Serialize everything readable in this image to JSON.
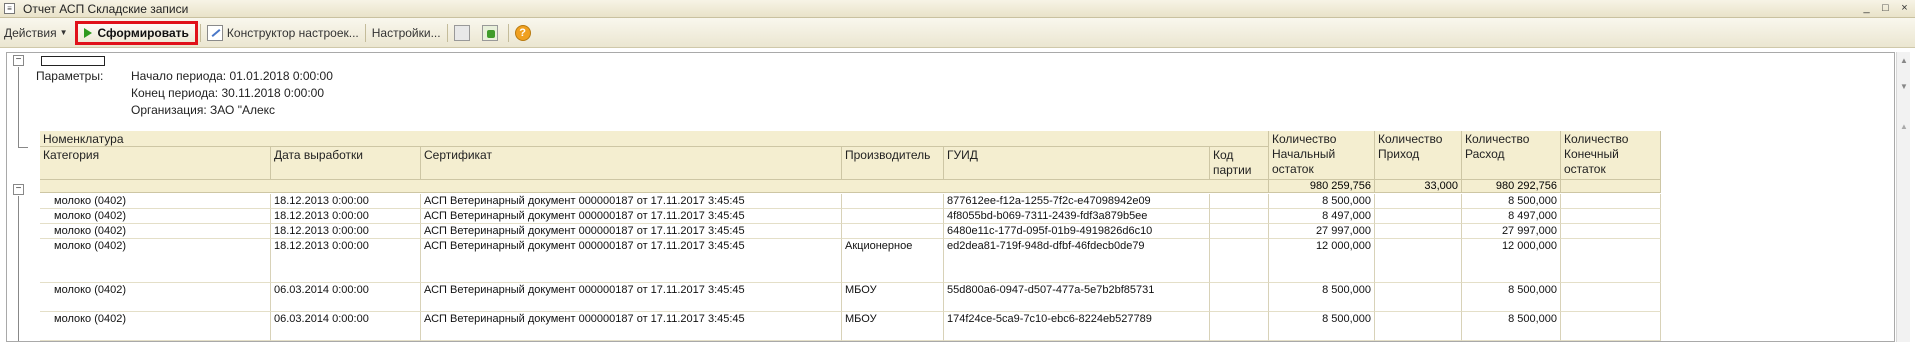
{
  "window": {
    "title": "Отчет  АСП Складские записи",
    "app_icon": "1c-document-icon",
    "controls": [
      "_",
      "□",
      "×"
    ]
  },
  "toolbar": {
    "actions_label": "Действия",
    "generate_label": "Сформировать",
    "designer_label": "Конструктор настроек...",
    "settings_label": "Настройки...",
    "help_glyph": "?"
  },
  "params": {
    "label": "Параметры:",
    "period_start": "Начало периода: 01.01.2018 0:00:00",
    "period_end": "Конец периода: 30.11.2018 0:00:00",
    "organization": "Организация: ЗАО \"Алекс"
  },
  "table": {
    "header_top": "Номенклатура",
    "columns": {
      "category": "Категория",
      "date": "Дата выработки",
      "cert": "Сертификат",
      "producer": "Производитель",
      "guid": "ГУИД",
      "batch": "Код партии",
      "qty_start": "Количество Начальный остаток",
      "qty_in": "Количество Приход",
      "qty_out": "Количество Расход",
      "qty_end": "Количество Конечный остаток"
    },
    "totals": {
      "qty_start": "980 259,756",
      "qty_in": "33,000",
      "qty_out": "980 292,756",
      "qty_end": ""
    },
    "rows": [
      {
        "category": "молоко (0402)",
        "date": "18.12.2013 0:00:00",
        "cert": "АСП Ветеринарный документ 000000187 от 17.11.2017 3:45:45",
        "producer": "",
        "guid": "877612ee-f12a-1255-7f2c-e47098942e09",
        "batch": "",
        "qty_start": "8 500,000",
        "qty_in": "",
        "qty_out": "8 500,000",
        "qty_end": ""
      },
      {
        "category": "молоко (0402)",
        "date": "18.12.2013 0:00:00",
        "cert": "АСП Ветеринарный документ 000000187 от 17.11.2017 3:45:45",
        "producer": "",
        "guid": "4f8055bd-b069-7311-2439-fdf3a879b5ee",
        "batch": "",
        "qty_start": "8 497,000",
        "qty_in": "",
        "qty_out": "8 497,000",
        "qty_end": ""
      },
      {
        "category": "молоко (0402)",
        "date": "18.12.2013 0:00:00",
        "cert": "АСП Ветеринарный документ 000000187 от 17.11.2017 3:45:45",
        "producer": "",
        "guid": "6480e11c-177d-095f-01b9-4919826d6c10",
        "batch": "",
        "qty_start": "27 997,000",
        "qty_in": "",
        "qty_out": "27 997,000",
        "qty_end": ""
      },
      {
        "category": "молоко (0402)",
        "date": "18.12.2013 0:00:00",
        "cert": "АСП Ветеринарный документ 000000187 от 17.11.2017 3:45:45",
        "producer": "Акционерное",
        "guid": "ed2dea81-719f-948d-dfbf-46fdecb0de79",
        "batch": "",
        "qty_start": "12 000,000",
        "qty_in": "",
        "qty_out": "12 000,000",
        "qty_end": ""
      },
      {
        "category": "молоко (0402)",
        "date": "06.03.2014 0:00:00",
        "cert": "АСП Ветеринарный документ 000000187 от 17.11.2017 3:45:45",
        "producer": "МБОУ",
        "guid": "55d800a6-0947-d507-477a-5e7b2bf85731",
        "batch": "",
        "qty_start": "8 500,000",
        "qty_in": "",
        "qty_out": "8 500,000",
        "qty_end": ""
      },
      {
        "category": "молоко (0402)",
        "date": "06.03.2014 0:00:00",
        "cert": "АСП Ветеринарный документ 000000187 от 17.11.2017 3:45:45",
        "producer": "МБОУ",
        "guid": "174f24ce-5ca9-7c10-ebc6-8224eb527789",
        "batch": "",
        "qty_start": "8 500,000",
        "qty_in": "",
        "qty_out": "8 500,000",
        "qty_end": ""
      }
    ]
  }
}
